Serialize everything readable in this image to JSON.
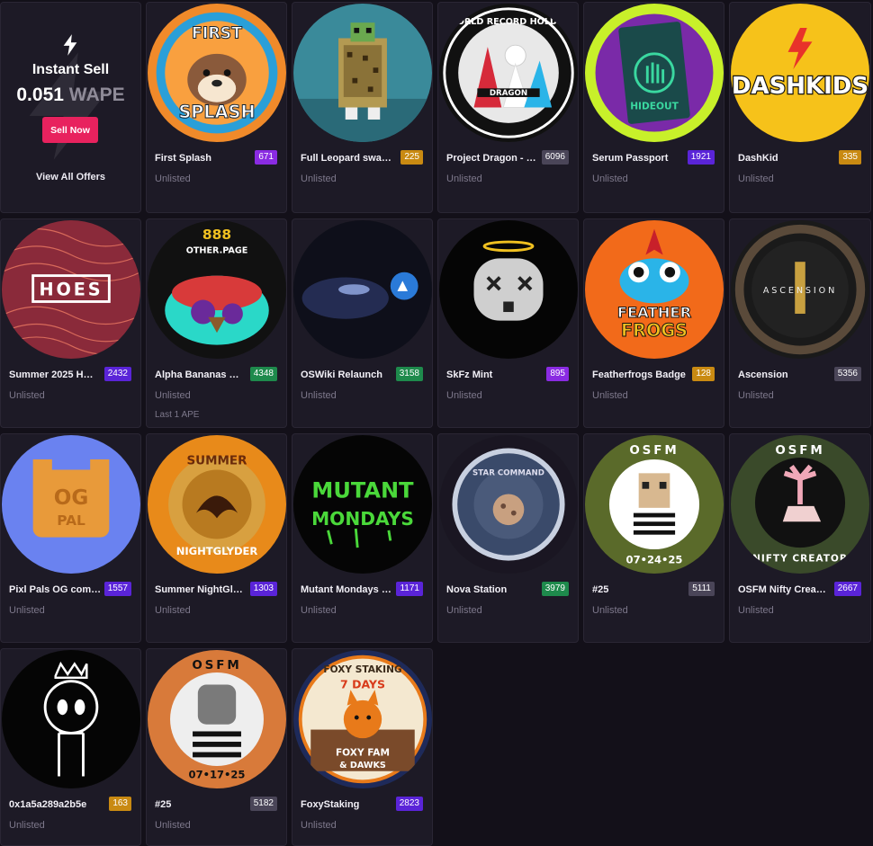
{
  "instant_sell": {
    "title": "Instant Sell",
    "amount": "0.051",
    "currency": "WAPE",
    "button_label": "Sell Now",
    "link_label": "View All Offers",
    "button_color": "#e8225e"
  },
  "badge_colors": {
    "purple": "#8a2be2",
    "orange": "#c98a12",
    "gray": "#4a4558",
    "indigo": "#5a24d8",
    "green": "#1e8a4c"
  },
  "items": [
    {
      "name": "First Splash",
      "count": "671",
      "badge": "purple",
      "status": "Unlisted",
      "art": "first-splash"
    },
    {
      "name": "Full Leopard swag…",
      "count": "225",
      "badge": "orange",
      "status": "Unlisted",
      "art": "leopard"
    },
    {
      "name": "Project Dragon - …",
      "count": "6096",
      "badge": "gray",
      "status": "Unlisted",
      "art": "dragon",
      "art_text": "WORLD RECORD HOLDER"
    },
    {
      "name": "Serum Passport",
      "count": "1921",
      "badge": "indigo",
      "status": "Unlisted",
      "art": "serum",
      "art_text": "HIDEOUT"
    },
    {
      "name": "DashKid",
      "count": "335",
      "badge": "orange",
      "status": "Unlisted",
      "art": "dashkids",
      "art_text": "DASHKIDS"
    },
    {
      "name": "Summer 2025 H…",
      "count": "2432",
      "badge": "indigo",
      "status": "Unlisted",
      "art": "hoes",
      "art_text": "HOES"
    },
    {
      "name": "Alpha Bananas …",
      "count": "4348",
      "badge": "green",
      "status": "Unlisted",
      "extra": "Last 1 APE",
      "art": "bananas",
      "art_text": "888",
      "art_text2": "OTHER.PAGE"
    },
    {
      "name": "OSWiki Relaunch",
      "count": "3158",
      "badge": "green",
      "status": "Unlisted",
      "art": "oswiki"
    },
    {
      "name": "SkFz Mint",
      "count": "895",
      "badge": "purple",
      "status": "Unlisted",
      "art": "skfz"
    },
    {
      "name": "Featherfrogs Badge",
      "count": "128",
      "badge": "orange",
      "status": "Unlisted",
      "art": "featherfrogs",
      "art_text": "FEATHER",
      "art_text2": "FROGS"
    },
    {
      "name": "Ascension",
      "count": "5356",
      "badge": "gray",
      "status": "Unlisted",
      "art": "ascension",
      "art_text": "ASCENSION"
    },
    {
      "name": "Pixl Pals OG com…",
      "count": "1557",
      "badge": "indigo",
      "status": "Unlisted",
      "art": "pixlpals",
      "art_text": "OG",
      "art_text2": "PAL"
    },
    {
      "name": "Summer NightGl…",
      "count": "1303",
      "badge": "indigo",
      "status": "Unlisted",
      "art": "nightglyder",
      "art_text": "SUMMER",
      "art_text2": "NIGHTGLYDER"
    },
    {
      "name": "Mutant Mondays …",
      "count": "1171",
      "badge": "indigo",
      "status": "Unlisted",
      "art": "mutant",
      "art_text": "MUTANT",
      "art_text2": "MONDAYS"
    },
    {
      "name": "Nova Station",
      "count": "3979",
      "badge": "green",
      "status": "Unlisted",
      "art": "nova",
      "art_text": "STAR COMMAND"
    },
    {
      "name": "#25",
      "count": "5111",
      "badge": "gray",
      "status": "Unlisted",
      "art": "osfm-punk",
      "art_text": "OSFM",
      "art_text2": "07•24•25"
    },
    {
      "name": "OSFM Nifty Crea…",
      "count": "2667",
      "badge": "indigo",
      "status": "Unlisted",
      "art": "osfm-nifty",
      "art_text": "OSFM",
      "art_text2": "NIFTY CREATOR"
    },
    {
      "name": "0x1a5a289a2b5e",
      "count": "163",
      "badge": "orange",
      "status": "Unlisted",
      "art": "crown"
    },
    {
      "name": "#25",
      "count": "5182",
      "badge": "gray",
      "status": "Unlisted",
      "art": "osfm-ape",
      "art_text": "OSFM",
      "art_text2": "07•17•25"
    },
    {
      "name": "FoxyStaking",
      "count": "2823",
      "badge": "indigo",
      "status": "Unlisted",
      "art": "foxy",
      "art_text": "FOXY STAKING",
      "art_text2": "7 DAYS",
      "art_text3": "FOXY FAM",
      "art_text4": "& DAWKS"
    }
  ]
}
